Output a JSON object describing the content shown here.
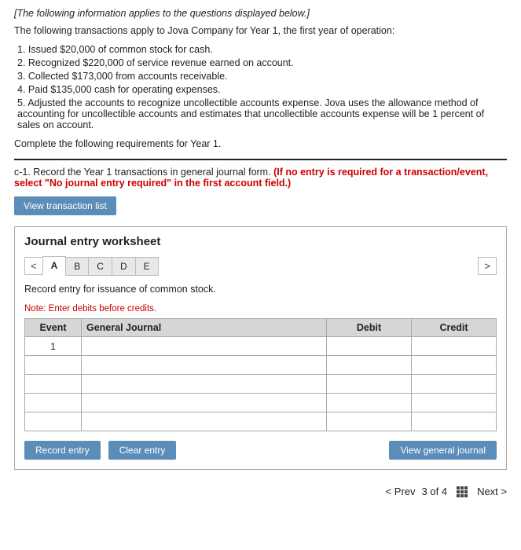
{
  "page": {
    "italic_note": "[The following information applies to the questions displayed below.]",
    "intro": "The following transactions apply to Jova Company for Year 1, the first year of operation:",
    "transactions": [
      "1.  Issued $20,000 of common stock for cash.",
      "2.  Recognized $220,000 of service revenue earned on account.",
      "3.  Collected $173,000 from accounts receivable.",
      "4.  Paid $135,000 cash for operating expenses.",
      "5.  Adjusted the accounts to recognize uncollectible accounts expense. Jova uses the allowance method of accounting for uncollectible accounts and estimates that uncollectible accounts expense will be 1 percent of sales on account."
    ],
    "complete_text": "Complete the following requirements for Year 1.",
    "instruction_prefix": "c-1. Record the Year 1 transactions in general journal form.",
    "instruction_bold": "(If no entry is required for a transaction/event, select \"No journal entry required\" in the first account field.)",
    "view_transaction_btn": "View transaction list",
    "worksheet": {
      "title": "Journal entry worksheet",
      "tabs": [
        "A",
        "B",
        "C",
        "D",
        "E"
      ],
      "active_tab": "A",
      "record_desc": "Record entry for issuance of common stock.",
      "note": "Note: Enter debits before credits.",
      "table": {
        "headers": [
          "Event",
          "General Journal",
          "Debit",
          "Credit"
        ],
        "rows": [
          {
            "event": "1",
            "journal": "",
            "debit": "",
            "credit": ""
          },
          {
            "event": "",
            "journal": "",
            "debit": "",
            "credit": ""
          },
          {
            "event": "",
            "journal": "",
            "debit": "",
            "credit": ""
          },
          {
            "event": "",
            "journal": "",
            "debit": "",
            "credit": ""
          },
          {
            "event": "",
            "journal": "",
            "debit": "",
            "credit": ""
          }
        ]
      },
      "record_entry_btn": "Record entry",
      "clear_entry_btn": "Clear entry",
      "view_general_btn": "View general journal"
    },
    "pagination": {
      "prev": "< Prev",
      "page_info": "3 of 4",
      "next": "Next >"
    }
  }
}
